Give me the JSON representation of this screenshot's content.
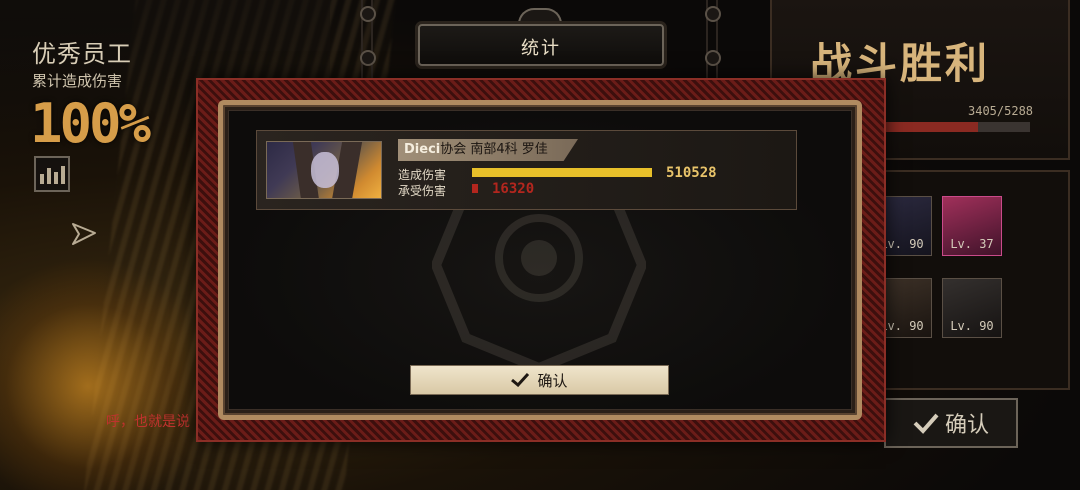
{
  "hud": {
    "title": "优秀员工",
    "subtitle": "累计造成伤害",
    "percent": "100%",
    "dialog": "呼，也就是说"
  },
  "header": {
    "title": "统计"
  },
  "victory_screen": {
    "title": "战斗胜利",
    "exp_text": "3405/5288",
    "exp_fraction": 0.644,
    "confirm_label": "确认",
    "team": [
      {
        "level": "Lv. 90"
      },
      {
        "level": "Lv. 37"
      },
      {
        "level": "Lv. 90"
      },
      {
        "level": "Lv. 90"
      }
    ]
  },
  "stats": {
    "entries": [
      {
        "org": "Dieci",
        "name_rest": "协会 南部4科 罗佳",
        "dealt_label": "造成伤害",
        "taken_label": "承受伤害",
        "dealt_value": "510528",
        "taken_value": "16320",
        "dealt_fraction": 1.0,
        "taken_fraction": 0.032
      }
    ],
    "confirm_label": "确认"
  },
  "colors": {
    "dealt_bar": "#e8c02a",
    "taken_bar": "#b3261e",
    "frame": "#b08a60",
    "accent_red": "#8b2e26"
  },
  "icons": [
    "stats-bars-icon",
    "send-arrow-icon",
    "checkmark-icon",
    "chain-link-icon"
  ]
}
